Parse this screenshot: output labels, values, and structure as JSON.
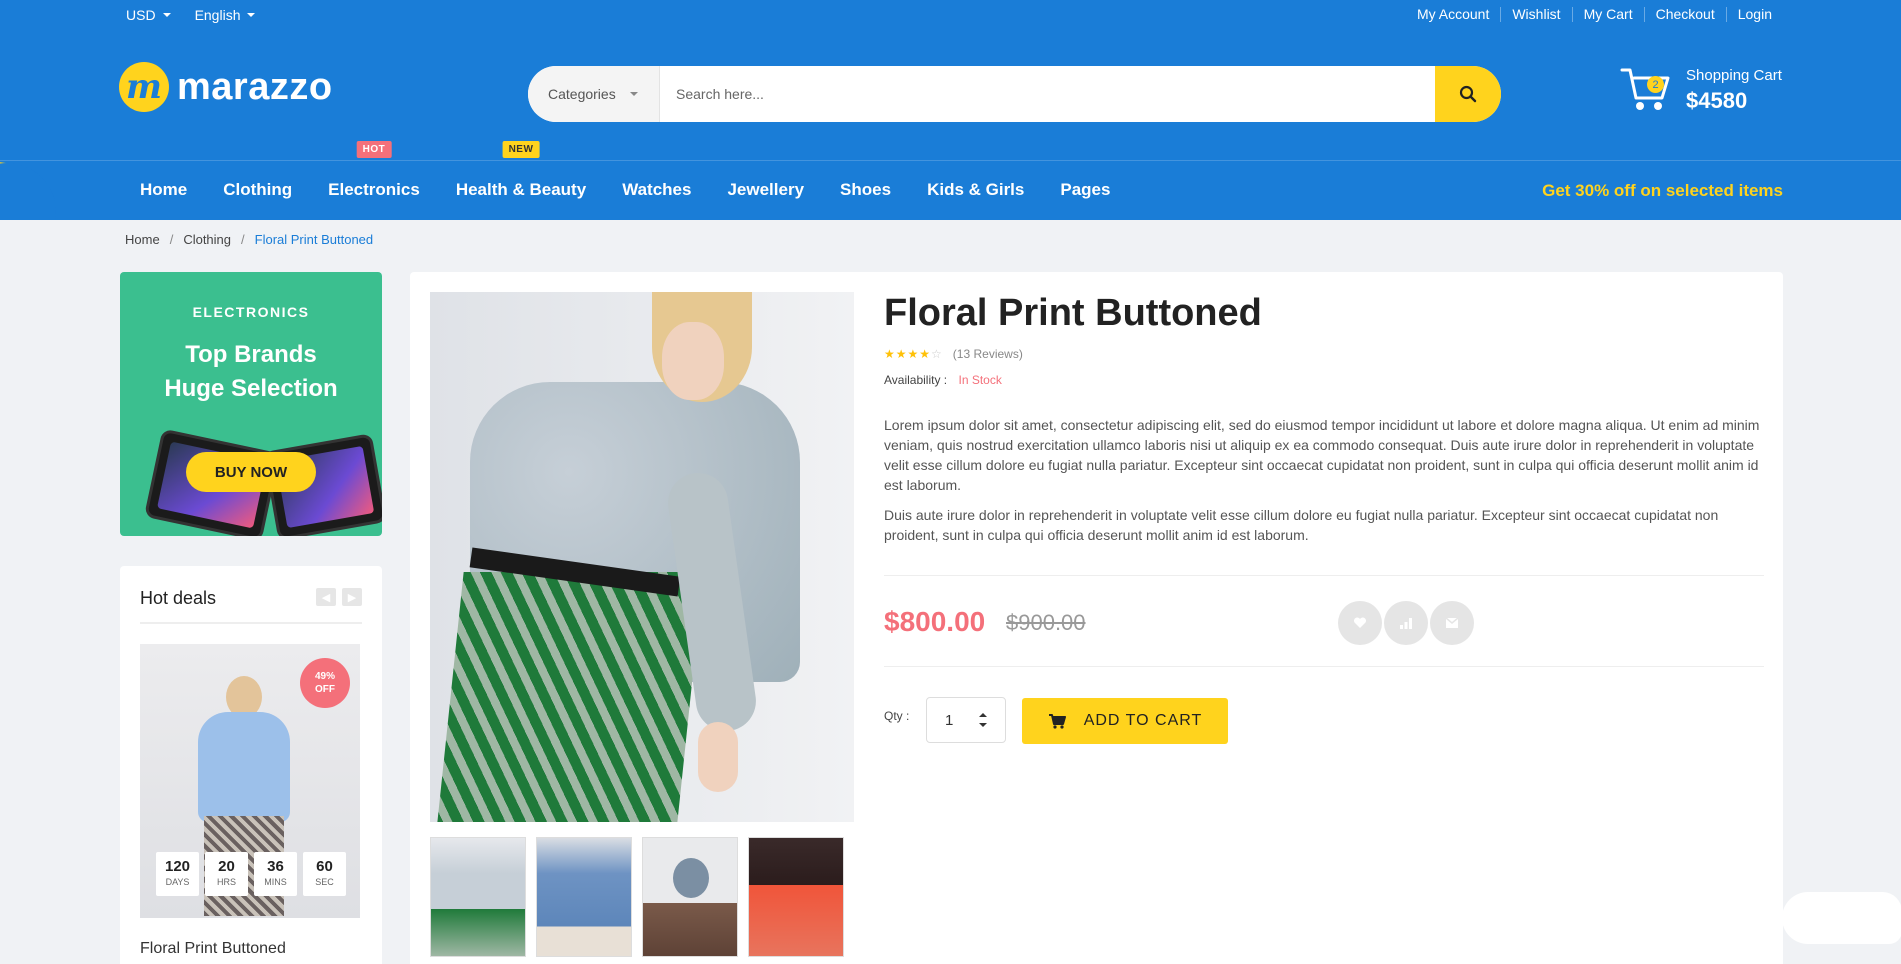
{
  "topbar": {
    "currency": "USD",
    "language": "English",
    "links": [
      "My Account",
      "Wishlist",
      "My Cart",
      "Checkout",
      "Login"
    ]
  },
  "brand": {
    "logo_letter": "m",
    "name": "marazzo"
  },
  "search": {
    "category": "Categories",
    "placeholder": "Search here..."
  },
  "cart": {
    "count": "2",
    "label": "Shopping Cart",
    "total": "$4580"
  },
  "nav": {
    "items": [
      "Home",
      "Clothing",
      "Electronics",
      "Health & Beauty",
      "Watches",
      "Jewellery",
      "Shoes",
      "Kids & Girls",
      "Pages"
    ],
    "tags": {
      "hot": "HOT",
      "new": "NEW"
    },
    "promo": "Get 30% off on selected items"
  },
  "breadcrumb": {
    "home": "Home",
    "category": "Clothing",
    "current": "Floral Print Buttoned"
  },
  "banner": {
    "kicker": "ELECTRONICS",
    "title_line1": "Top Brands",
    "title_line2": "Huge Selection",
    "button": "BUY NOW",
    "color": "#3bbf8f"
  },
  "hot_deals": {
    "title": "Hot deals",
    "discount_line1": "49%",
    "discount_line2": "OFF",
    "countdown": [
      {
        "value": "120",
        "unit": "DAYS"
      },
      {
        "value": "20",
        "unit": "HRS"
      },
      {
        "value": "36",
        "unit": "MINS"
      },
      {
        "value": "60",
        "unit": "SEC"
      }
    ],
    "product_name": "Floral Print Buttoned"
  },
  "product": {
    "title": "Floral Print Buttoned",
    "rating": 4,
    "reviews": "(13 Reviews)",
    "availability_label": "Availability :",
    "availability_value": "In Stock",
    "desc1": "Lorem ipsum dolor sit amet, consectetur adipiscing elit, sed do eiusmod tempor incididunt ut labore et dolore magna aliqua. Ut enim ad minim veniam, quis nostrud exercitation ullamco laboris nisi ut aliquip ex ea commodo consequat. Duis aute irure dolor in reprehenderit in voluptate velit esse cillum dolore eu fugiat nulla pariatur. Excepteur sint occaecat cupidatat non proident, sunt in culpa qui officia deserunt mollit anim id est laborum.",
    "desc2": "Duis aute irure dolor in reprehenderit in voluptate velit esse cillum dolore eu fugiat nulla pariatur. Excepteur sint occaecat cupidatat non proident, sunt in culpa qui officia deserunt mollit anim id est laborum.",
    "price": "$800.00",
    "old_price": "$900.00",
    "qty_label": "Qty :",
    "qty_value": "1",
    "add_to_cart": "ADD TO CART"
  },
  "colors": {
    "brand_blue": "#1a7dd7",
    "accent_yellow": "#ffd31d",
    "sale_red": "#f4707a"
  }
}
